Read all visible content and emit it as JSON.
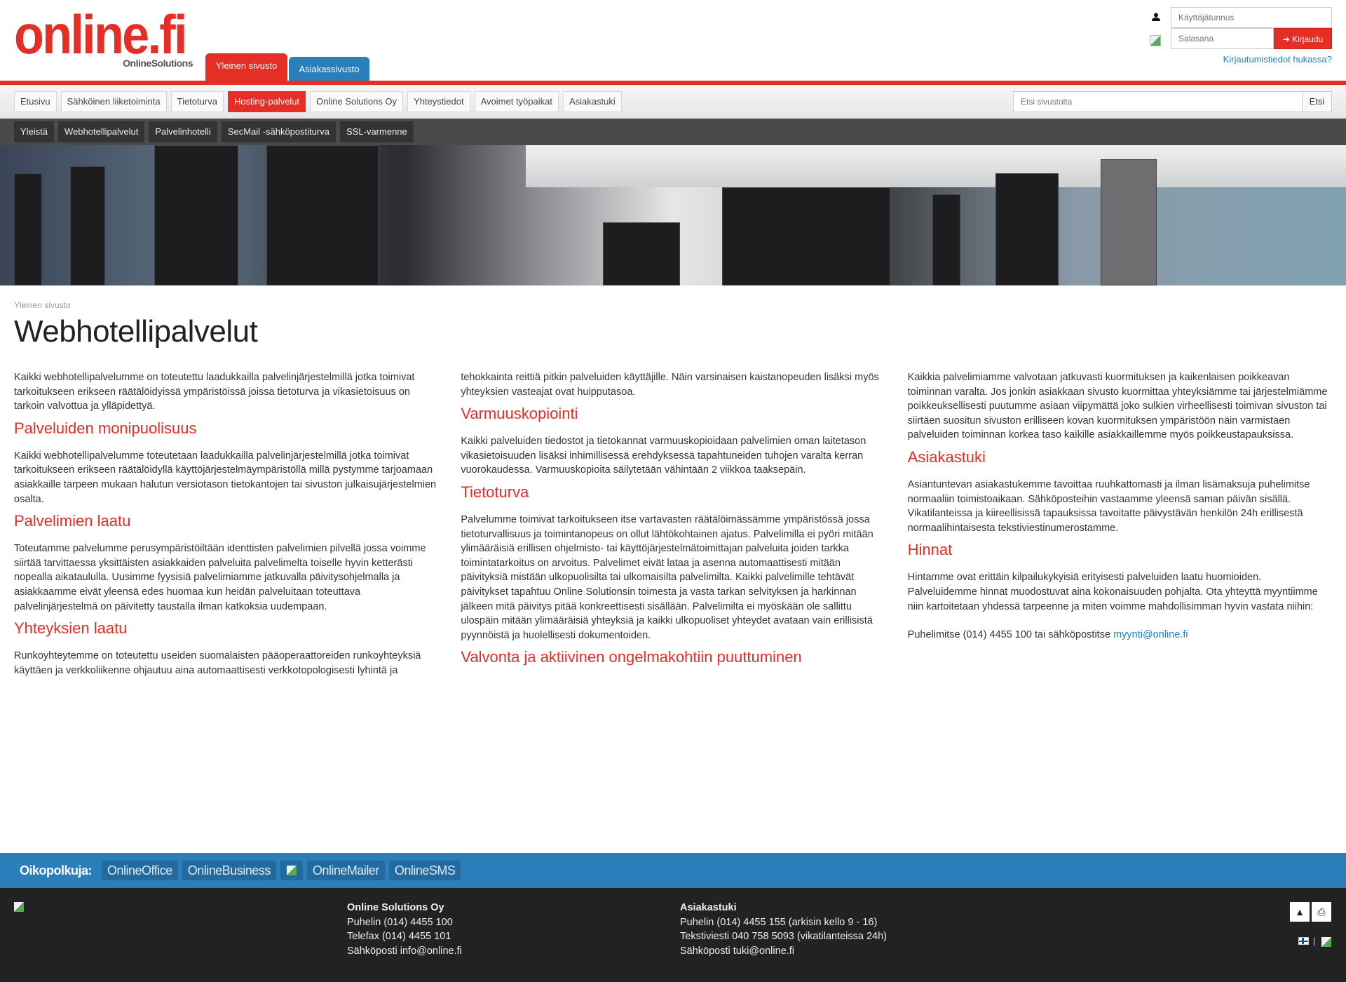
{
  "brand": {
    "logo": "online.fi",
    "tagline": "OnlineSolutions",
    "accent": "#e42e26",
    "blue": "#2a7fba"
  },
  "site_tabs": [
    {
      "label": "Yleinen sivusto",
      "active": true
    },
    {
      "label": "Asiakassivusto",
      "active": false
    }
  ],
  "login": {
    "username_placeholder": "Käyttäjätunnus",
    "password_placeholder": "Salasana",
    "submit": "Kirjaudu",
    "forgot": "Kirjautumistiedot hukassa?"
  },
  "nav": {
    "items": [
      {
        "label": "Etusivu"
      },
      {
        "label": "Sähköinen liiketoiminta"
      },
      {
        "label": "Tietoturva"
      },
      {
        "label": "Hosting-palvelut",
        "active": true
      },
      {
        "label": "Online Solutions Oy"
      },
      {
        "label": "Yhteystiedot"
      },
      {
        "label": "Avoimet työpaikat"
      },
      {
        "label": "Asiakastuki"
      }
    ]
  },
  "search": {
    "placeholder": "Etsi sivustolta",
    "button": "Etsi"
  },
  "subnav": {
    "items": [
      {
        "label": "Yleistä"
      },
      {
        "label": "Webhotellipalvelut"
      },
      {
        "label": "Palvelinhotelli"
      },
      {
        "label": "SecMail -sähköpostiturva"
      },
      {
        "label": "SSL-varmenne"
      }
    ]
  },
  "page": {
    "breadcrumb": "Yleinen sivusto",
    "title": "Webhotellipalvelut",
    "intro": "Kaikki webhotellipalvelumme on toteutettu laadukkailla palvelinjärjestelmillä jotka toimivat tarkoitukseen erikseen räätälöidyissä ympäristöissä joissa tietoturva ja vikasietoisuus on tarkoin valvottua ja ylläpidettyä.",
    "sections": [
      {
        "heading": "Palveluiden monipuolisuus",
        "text": "Kaikki webhotellipalvelumme toteutetaan laadukkailla palvelinjärjestelmillä jotka toimivat tarkoitukseen erikseen räätälöidyllä käyttöjärjestelmäympäristöllä millä pystymme tarjoamaan asiakkaille tarpeen mukaan halutun versiotason tietokantojen tai sivuston julkaisujärjestelmien osalta."
      },
      {
        "heading": "Palvelimien laatu",
        "text": "Toteutamme palvelumme perusympäristöiltään identtisten palvelimien pilvellä jossa voimme siirtää tarvittaessa yksittäisten asiakkaiden palveluita palvelimelta toiselle hyvin ketterästi nopealla aikataululla. Uusimme fyysisiä palvelimiamme jatkuvalla päivitysohjelmalla ja asiakkaamme eivät yleensä edes huomaa kun heidän palveluitaan toteuttava palvelinjärjestelmä on päivitetty taustalla ilman katkoksia uudempaan."
      },
      {
        "heading": "Yhteyksien laatu",
        "text": "Runkoyhteytemme on toteutettu useiden suomalaisten pääoperaattoreiden runkoyhteyksiä käyttäen ja verkkoliikenne ohjautuu aina automaattisesti verkkotopologisesti lyhintä ja tehokkainta reittiä pitkin palveluiden käyttäjille. Näin varsinaisen kaistanopeuden lisäksi myös yhteyksien vasteajat ovat huipputasoa."
      },
      {
        "heading": "Varmuuskopiointi",
        "text": "Kaikki palveluiden tiedostot ja tietokannat varmuuskopioidaan palvelimien oman laitetason vikasietoisuuden lisäksi inhimillisessä erehdyksessä tapahtuneiden tuhojen varalta kerran vuorokaudessa. Varmuuskopioita säilytetään vähintään 2 viikkoa taaksepäin."
      },
      {
        "heading": "Tietoturva",
        "text": "Palvelumme toimivat tarkoitukseen itse vartavasten räätälöimässämme ympäristössä jossa tietoturvallisuus ja toimintanopeus on ollut lähtökohtainen ajatus. Palvelimilla ei pyöri mitään ylimääräisiä erillisen ohjelmisto- tai käyttöjärjestelmätoimittajan palveluita joiden tarkka toimintatarkoitus on arvoitus. Palvelimet eivät lataa ja asenna automaattisesti mitään päivityksiä mistään ulkopuolisilta tai ulkomaisilta palvelimilta. Kaikki palvelimille tehtävät päivitykset tapahtuu Online Solutionsin toimesta ja vasta tarkan selvityksen ja harkinnan jälkeen mitä päivitys pitää konkreettisesti sisällään. Palvelimilta ei myöskään ole sallittu ulospäin mitään ylimääräisiä yhteyksiä ja kaikki ulkopuoliset yhteydet avataan vain erillisistä pyynnöistä ja huolellisesti dokumentoiden."
      },
      {
        "heading": "Valvonta ja aktiivinen ongelmakohtiin puuttuminen",
        "text": "Kaikkia palvelimiamme valvotaan jatkuvasti kuormituksen ja kaikenlaisen poikkeavan toiminnan varalta. Jos jonkin asiakkaan sivusto kuormittaa yhteyksiämme tai järjestelmiämme poikkeuksellisesti puutumme asiaan viipymättä joko sulkien virheellisesti toimivan sivuston tai siirtäen suositun sivuston erilliseen kovan kuormituksen ympäristöön näin varmistaen palveluiden toiminnan korkea taso kaikille asiakkaillemme myös poikkeustapauksissa."
      },
      {
        "heading": "Asiakastuki",
        "text": "Asiantuntevan asiakastukemme tavoittaa ruuhkattomasti ja ilman lisämaksuja puhelimitse normaaliin toimistoaikaan. Sähköposteihin vastaamme yleensä saman päivän sisällä. Vikatilanteissa ja kiireellisissä tapauksissa tavoitatte päivystävän henkilön 24h erillisestä normaalihintaisesta tekstiviestinumerostamme."
      },
      {
        "heading": "Hinnat",
        "text": "Hintamme ovat erittäin kilpailukykyisiä erityisesti palveluiden laatu huomioiden. Palveluidemme hinnat muodostuvat aina kokonaisuuden pohjalta. Ota yhteyttä myyntiimme niin kartoitetaan yhdessä tarpeenne ja miten voimme mahdollisimman hyvin vastata niihin:"
      }
    ],
    "contact_text": "Puhelimitse (014) 4455 100 tai sähköpostitse ",
    "contact_email": "myynti@online.fi"
  },
  "shortcuts": {
    "label": "Oikopolkuja:",
    "items": [
      "OnlineOffice",
      "OnlineBusiness",
      "OnlineMailer",
      "OnlineSMS"
    ]
  },
  "footer": {
    "company": {
      "title": "Online Solutions Oy",
      "lines": [
        "Puhelin (014) 4455 100",
        "Telefax (014) 4455 101",
        "Sähköposti info@online.fi"
      ]
    },
    "support": {
      "title": "Asiakastuki",
      "lines": [
        "Puhelin (014) 4455 155 (arkisin kello 9 - 16)",
        "Tekstiviesti 040 758 5093 (vikatilanteissa 24h)",
        "Sähköposti tuki@online.fi"
      ]
    },
    "separator": "|"
  }
}
